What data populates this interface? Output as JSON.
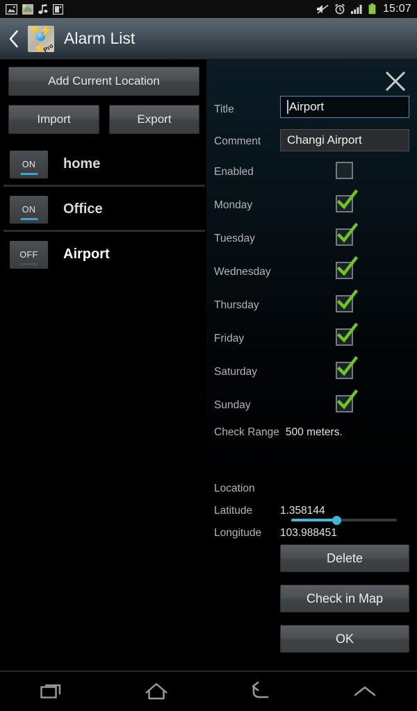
{
  "status_bar": {
    "time": "15:07",
    "left_icons": [
      "image-icon",
      "map-app-icon",
      "music-note-icon",
      "sd-card-icon"
    ],
    "right_icons": [
      "mute-icon",
      "alarm-clock-icon",
      "signal-bars-icon",
      "battery-icon"
    ]
  },
  "action_bar": {
    "title": "Alarm List",
    "back_icon": "back-chevron-icon",
    "app_icon": "map-pro-app-icon",
    "app_icon_badge": "Pro"
  },
  "left_panel": {
    "add_button": "Add Current Location",
    "import_button": "Import",
    "export_button": "Export",
    "alarms": [
      {
        "name": "home",
        "state": "ON",
        "selected": false
      },
      {
        "name": "Office",
        "state": "ON",
        "selected": false
      },
      {
        "name": "Airport",
        "state": "OFF",
        "selected": true
      }
    ]
  },
  "detail_panel": {
    "close_icon": "close-x-icon",
    "title_label": "Title",
    "title_value": "Airport",
    "comment_label": "Comment",
    "comment_value": "Changi Airport",
    "enabled_label": "Enabled",
    "enabled_checked": false,
    "days": [
      {
        "label": "Monday",
        "checked": true
      },
      {
        "label": "Tuesday",
        "checked": true
      },
      {
        "label": "Wednesday",
        "checked": true
      },
      {
        "label": "Thursday",
        "checked": true
      },
      {
        "label": "Friday",
        "checked": true
      },
      {
        "label": "Saturday",
        "checked": true
      },
      {
        "label": "Sunday",
        "checked": true
      }
    ],
    "check_range_label": "Check Range",
    "check_range_value": "500 meters.",
    "slider_percent": 43,
    "location_label": "Location",
    "latitude_label": "Latitude",
    "latitude_value": "1.358144",
    "longitude_label": "Longitude",
    "longitude_value": "103.988451",
    "delete_button": "Delete",
    "check_in_map_button": "Check in Map",
    "ok_button": "OK"
  },
  "nav_bar": {
    "recents_icon": "recents-icon",
    "home_icon": "home-icon",
    "back_icon": "back-arrow-icon",
    "menu_icon": "chevron-up-icon"
  },
  "colors": {
    "accent_blue": "#3cb8e0",
    "check_green": "#6ec520",
    "focus_border": "#4a8fc0",
    "battery_green": "#8ec63f"
  }
}
